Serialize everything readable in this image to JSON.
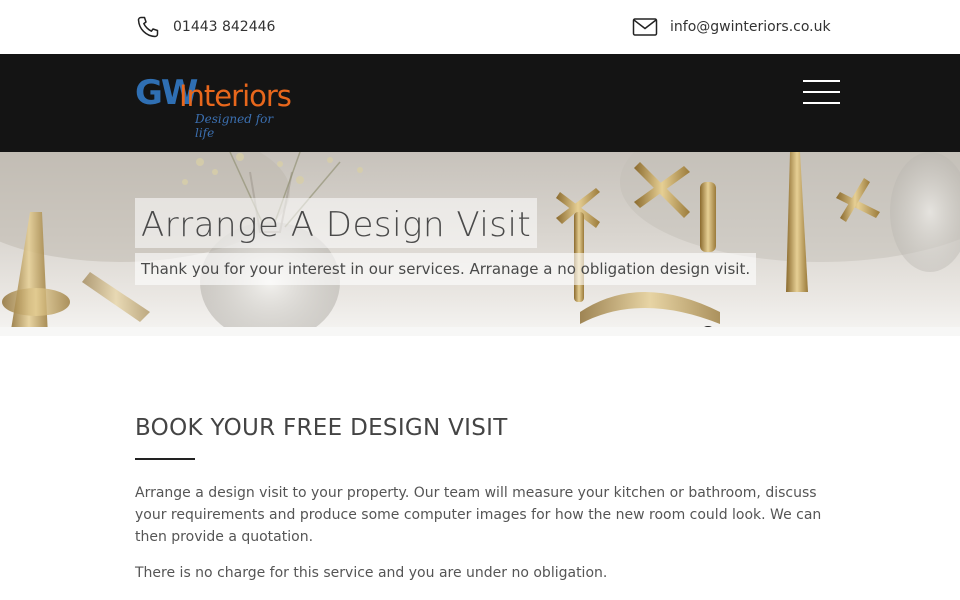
{
  "topbar": {
    "phone": {
      "icon": "phone-icon",
      "text": "01443 842446"
    },
    "email": {
      "icon": "envelope-icon",
      "text": "info@gwinteriors.co.uk"
    }
  },
  "header": {
    "logo": {
      "gw": "GW",
      "interiors": "Interiors",
      "tagline": "Designed for life"
    },
    "menu_icon": "hamburger-menu-icon",
    "colors": {
      "background": "#141414",
      "logo_blue": "#2f6fb3",
      "logo_orange": "#e8671c"
    }
  },
  "hero": {
    "title": "Arrange A Design Visit",
    "subtitle": "Thank you for your interest in our services. Arranage a no obligation design visit."
  },
  "main": {
    "heading": "BOOK YOUR FREE DESIGN VISIT",
    "paragraphs": [
      "Arrange a design visit to your property. Our team will measure your kitchen or bathroom, discuss your requirements and produce some computer images for how the new room could look. We can then provide a quotation.",
      "There is no charge for this service and you are under no obligation."
    ]
  }
}
